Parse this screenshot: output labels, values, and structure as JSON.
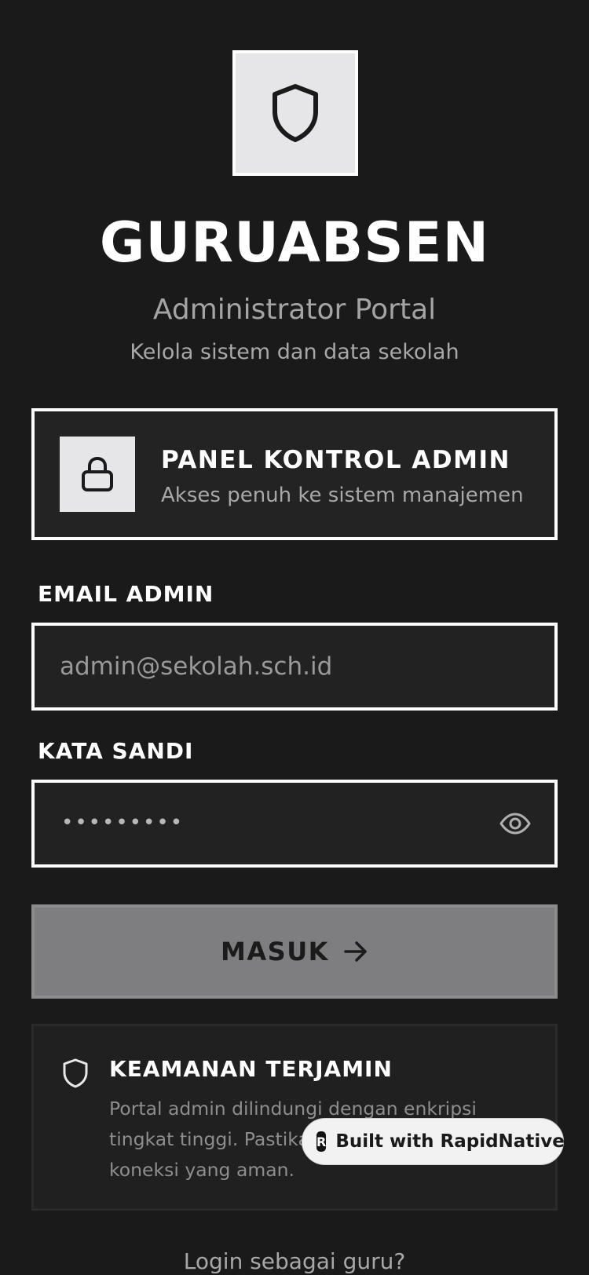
{
  "app": {
    "title": "GURUABSEN",
    "subtitle": "Administrator Portal",
    "tagline": "Kelola sistem dan data sekolah"
  },
  "panel": {
    "title": "PANEL KONTROL ADMIN",
    "description": "Akses penuh ke sistem manajemen"
  },
  "form": {
    "email_label": "EMAIL ADMIN",
    "email_placeholder": "admin@sekolah.sch.id",
    "password_label": "KATA SANDI",
    "password_masked": "•••••••••",
    "submit_label": "MASUK"
  },
  "security": {
    "title": "KEAMANAN TERJAMIN",
    "text": "Portal admin dilindungi dengan enkripsi tingkat tinggi. Pastikan Anda menggunakan koneksi yang aman."
  },
  "badge": {
    "label": "Built with RapidNative",
    "logo_letter": "R"
  },
  "footer": {
    "teacher_login": "Login sebagai guru?"
  },
  "colors": {
    "background": "#1a1a1b",
    "surface": "#232324",
    "button": "#7e7e80",
    "icon_box": "#e6e6e8"
  },
  "icons": {
    "logo": "shield-icon",
    "panel": "lock-icon",
    "password_toggle": "eye-icon",
    "submit": "arrow-right-icon",
    "security": "shield-icon"
  }
}
